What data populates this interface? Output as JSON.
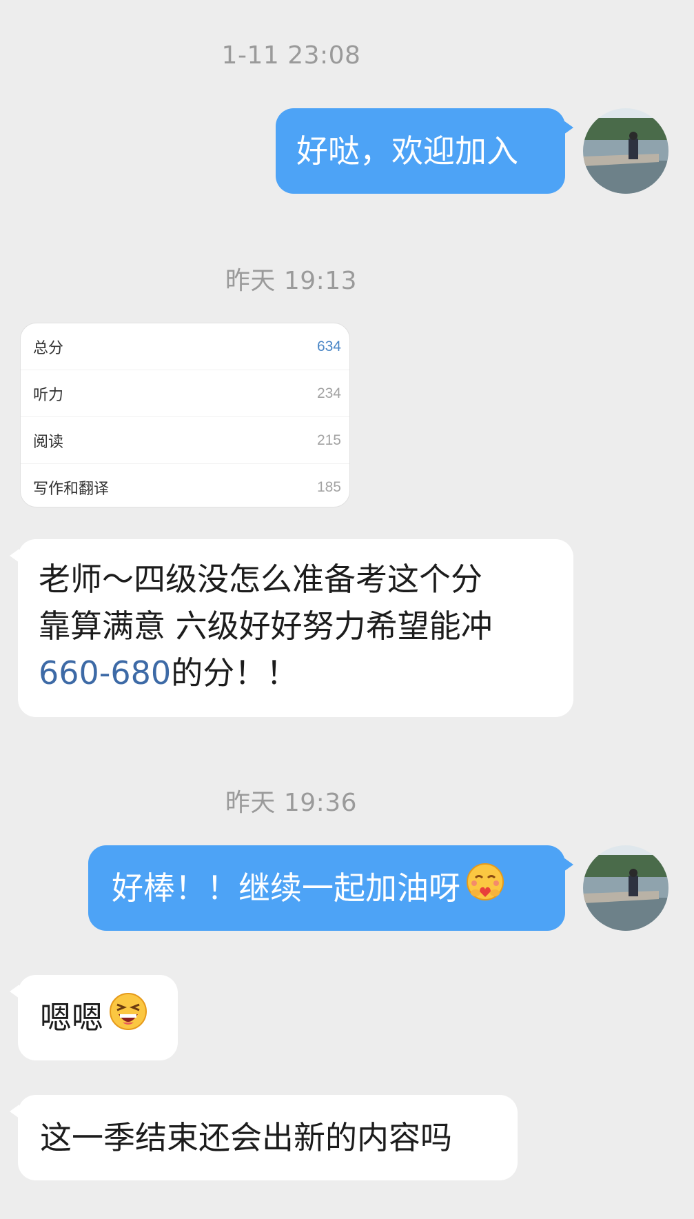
{
  "timestamps": [
    "1-11 23:08",
    "昨天 19:13",
    "昨天 19:36"
  ],
  "messages": {
    "m1": "好哒，欢迎加入",
    "m3_line1": "老师～四级没怎么准备考这个分",
    "m3_line2": "靠算满意 六级好好努力希望能冲",
    "m3_link": "660-680",
    "m3_tail": "的分！！",
    "m4": "好棒！！继续一起加油呀",
    "m5": "嗯嗯",
    "m6": "这一季结束还会出新的内容吗"
  },
  "score_card": {
    "rows": [
      {
        "label": "总分",
        "value": "634"
      },
      {
        "label": "听力",
        "value": "234"
      },
      {
        "label": "阅读",
        "value": "215"
      },
      {
        "label": "写作和翻译",
        "value": "185"
      }
    ]
  },
  "icons": {
    "avatar": "avatar-photo-icon",
    "hug_emoji": "hugging-face-icon",
    "laugh_emoji": "laughing-face-icon"
  },
  "colors": {
    "background": "#ededed",
    "my_bubble": "#4da3f6",
    "their_bubble": "#ffffff",
    "timestamp": "#9a9a9a",
    "link": "#3d6aa6"
  }
}
